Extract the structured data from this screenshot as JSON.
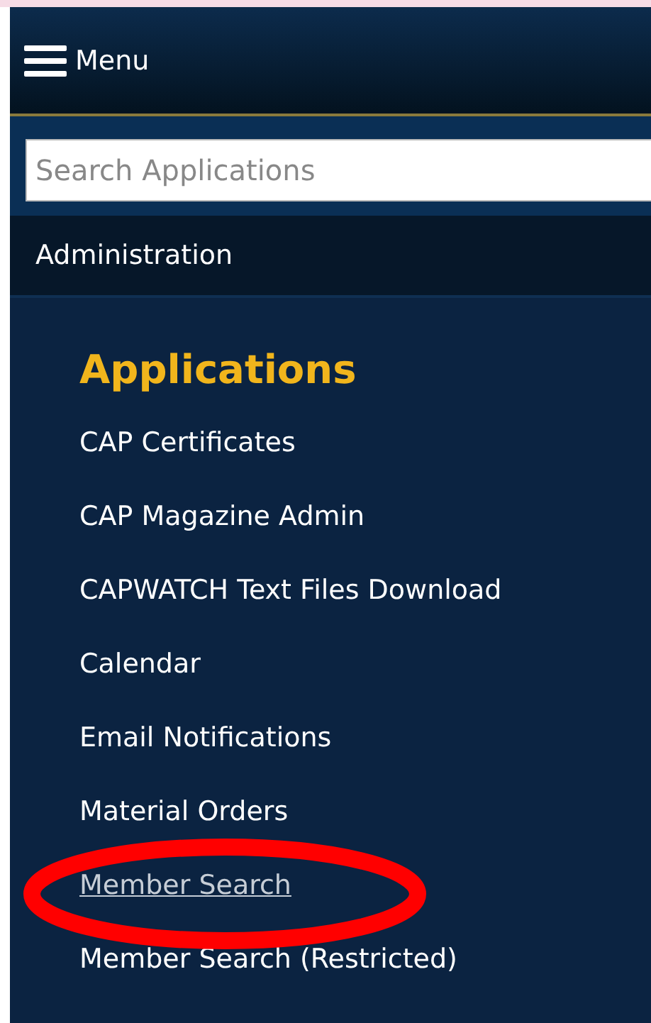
{
  "header": {
    "menu_label": "Menu"
  },
  "search": {
    "placeholder": "Search Applications"
  },
  "section": {
    "label": "Administration"
  },
  "applications": {
    "heading": "Applications",
    "items": [
      {
        "label": "CAP Certificates",
        "selected": false
      },
      {
        "label": "CAP Magazine Admin",
        "selected": false
      },
      {
        "label": "CAPWATCH Text Files Download",
        "selected": false
      },
      {
        "label": "Calendar",
        "selected": false
      },
      {
        "label": "Email Notifications",
        "selected": false
      },
      {
        "label": "Material Orders",
        "selected": false
      },
      {
        "label": "Member Search",
        "selected": true
      },
      {
        "label": "Member Search (Restricted)",
        "selected": false
      }
    ]
  }
}
